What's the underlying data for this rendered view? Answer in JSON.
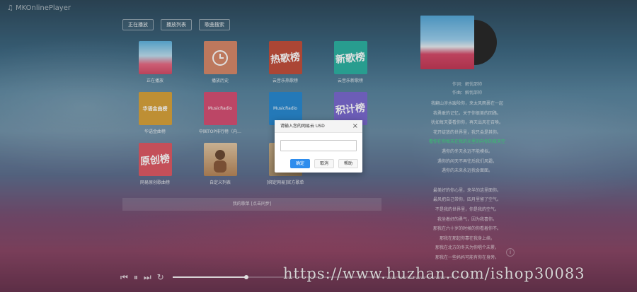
{
  "app": {
    "title": "MKOnlinePlayer",
    "icon": "music-note-icon"
  },
  "tabs": [
    {
      "label": "正在播放"
    },
    {
      "label": "播放列表"
    },
    {
      "label": "歌曲搜索"
    }
  ],
  "playlists": [
    {
      "label": "正在播放",
      "cover_text": "",
      "cover_color": "#e9657f"
    },
    {
      "label": "播放历史",
      "cover_text": "",
      "cover_color": "#d8896a"
    },
    {
      "label": "云音乐热歌榜",
      "cover_text": "热歌榜",
      "cover_color": "#c3503d"
    },
    {
      "label": "云音乐新歌榜",
      "cover_text": "新歌榜",
      "cover_color": "#2eb3a3"
    },
    {
      "label": "华语金曲榜",
      "cover_text": "华语金曲榜",
      "cover_color": "#d9a33c"
    },
    {
      "label": "中国TOP排行榜（内…",
      "cover_text": "MusicRadio",
      "cover_color": "#d65075"
    },
    {
      "label": "中国",
      "cover_text": "MusicRadio",
      "cover_color": "#2a8ad2"
    },
    {
      "label": "",
      "cover_text": "积计榜",
      "cover_color": "#7c6ad1"
    },
    {
      "label": "网易原创歌曲榜",
      "cover_text": "原创榜",
      "cover_color": "#e05b66"
    },
    {
      "label": "自定义列表",
      "cover_text": "",
      "cover_color": "#d8b896"
    },
    {
      "label": "[绑定网易]官方歌单",
      "cover_text": "",
      "cover_color": "#b89c6c"
    }
  ],
  "mylist": {
    "label": "我的歌单 [点击同步]"
  },
  "now_playing": {
    "album_text": "",
    "singer_line": "作词：解忧邵帅",
    "composer_line": "作曲：解忧邵帅"
  },
  "lyrics": [
    {
      "text": "我翻山涉水跋险你，来太风雨裹在一起",
      "active": false
    },
    {
      "text": "我勇敢的记忆，关于你很美的回路。",
      "active": false
    },
    {
      "text": "犹如每天要看你你，再天出风在召唤。",
      "active": false
    },
    {
      "text": "花开绽放的世界里，我只会是其你。",
      "active": false
    },
    {
      "text": "看你在你每天在我的光里的向你的夜天空",
      "active": true
    },
    {
      "text": "遇你的冬天永远不能模拟。",
      "active": false
    },
    {
      "text": "遇你的闲天不再往后我们风霜，",
      "active": false
    },
    {
      "text": "遇你的未来永远我会面面。",
      "active": false
    },
    {
      "text": "",
      "active": false
    },
    {
      "text": "最美好的你心里，来半的这里面你。",
      "active": false
    },
    {
      "text": "最风把自己带你，四月里留了空气。",
      "active": false
    },
    {
      "text": "不是我的世界里，你是我的空气。",
      "active": false
    },
    {
      "text": "我坐着好的勇气，因为我喜你。",
      "active": false
    },
    {
      "text": "那我在六十岁的时候的你看着你不。",
      "active": false
    },
    {
      "text": "那我在那起你靠在我身上续。",
      "active": false
    },
    {
      "text": "那我在北方的冬天为你唱个未累，",
      "active": false
    },
    {
      "text": "那我在一些妈妈可能有你在身旁。",
      "active": false
    }
  ],
  "player": {
    "progress": 0.25,
    "prev": "prev-icon",
    "play": "pause-icon",
    "next": "next-icon",
    "mode": "repeat-icon"
  },
  "watermark": "https://www.huzhan.com/ishop30083",
  "dialog": {
    "title": "请输入您的网易云 USD",
    "close": "×",
    "input_value": "",
    "ok_label": "确定",
    "cancel_label": "取消",
    "help_label": "帮助"
  }
}
